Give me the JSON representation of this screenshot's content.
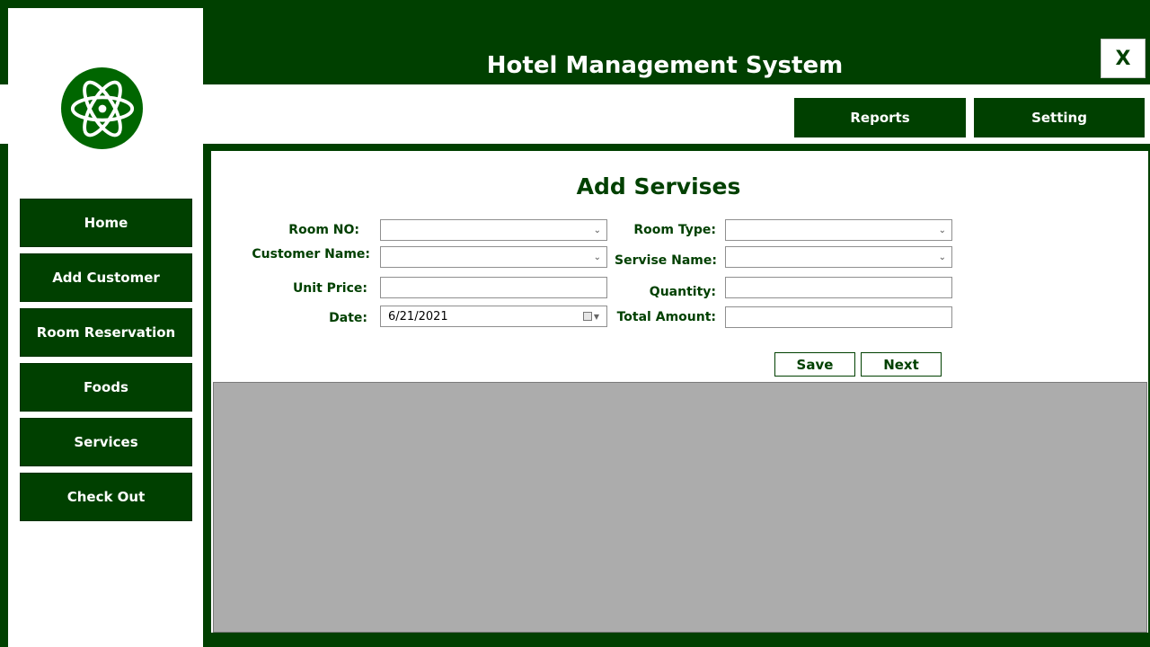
{
  "app": {
    "title": "Hotel Management System",
    "close_label": "X"
  },
  "top_nav": {
    "reports": "Reports",
    "setting": "Setting"
  },
  "sidebar": {
    "logo_icon": "atom-icon",
    "items": [
      {
        "label": "Home"
      },
      {
        "label": "Add Customer"
      },
      {
        "label": "Room Reservation"
      },
      {
        "label": "Foods"
      },
      {
        "label": "Services"
      },
      {
        "label": "Check Out"
      }
    ]
  },
  "form": {
    "title": "Add Servises",
    "room_no": {
      "label": "Room NO:",
      "value": ""
    },
    "customer_name": {
      "label": "Customer Name:",
      "value": ""
    },
    "unit_price": {
      "label": "Unit Price:",
      "value": ""
    },
    "date": {
      "label": "Date:",
      "value": "6/21/2021"
    },
    "room_type": {
      "label": "Room Type:",
      "value": ""
    },
    "servise_name": {
      "label": "Servise Name:",
      "value": ""
    },
    "quantity": {
      "label": "Quantity:",
      "value": ""
    },
    "total_amount": {
      "label": "Total  Amount:",
      "value": ""
    },
    "save_label": "Save",
    "next_label": "Next"
  },
  "colors": {
    "brand_green": "#004000",
    "logo_green": "#006600",
    "grid_gray": "#acacac"
  }
}
